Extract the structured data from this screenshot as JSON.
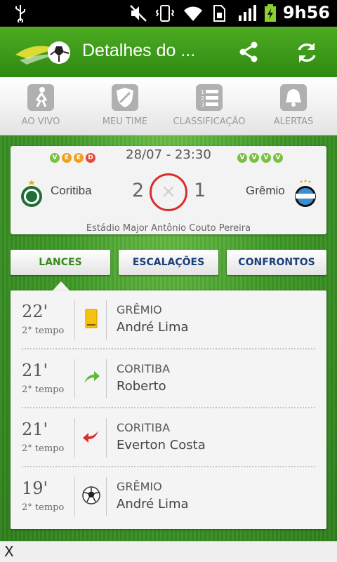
{
  "status_bar": {
    "time": "9h56",
    "icons": [
      "usb-icon",
      "mute-icon",
      "vibrate-icon",
      "wifi-icon",
      "sim-icon",
      "signal-icon",
      "battery-charging-icon"
    ]
  },
  "app_bar": {
    "title": "Detalhes do ...",
    "logo_icon": "soccer-ball-logo",
    "share_icon": "share-icon",
    "refresh_icon": "refresh-icon",
    "accent": "#3b9b1b"
  },
  "tabs": [
    {
      "label": "AO VIVO",
      "icon": "player-icon"
    },
    {
      "label": "MEU TIME",
      "icon": "shield-icon"
    },
    {
      "label": "CLASSIFICAÇÃO",
      "icon": "ranking-list-icon"
    },
    {
      "label": "ALERTAS",
      "icon": "bell-icon"
    }
  ],
  "match": {
    "datetime": "28/07 - 23:30",
    "home": {
      "name": "Coritiba",
      "score": "2",
      "form": [
        "V",
        "E",
        "E",
        "D"
      ]
    },
    "away": {
      "name": "Grêmio",
      "score": "1",
      "form": [
        "V",
        "V",
        "V",
        "V"
      ]
    },
    "vs_symbol": "×",
    "stadium": "Estádio Major Antônio Couto Pereira",
    "form_colors": {
      "V": "#7ac143",
      "E": "#f0a020",
      "D": "#e24a3b"
    }
  },
  "segments": [
    {
      "label": "LANCES",
      "active": true
    },
    {
      "label": "ESCALAÇÕES",
      "active": false
    },
    {
      "label": "CONFRONTOS",
      "active": false
    }
  ],
  "events": [
    {
      "minute": "22'",
      "period": "2° tempo",
      "team": "GRÊMIO",
      "player": "André Lima",
      "icon": "yellow-card-icon"
    },
    {
      "minute": "21'",
      "period": "2° tempo",
      "team": "CORITIBA",
      "player": "Roberto",
      "icon": "substitution-in-icon"
    },
    {
      "minute": "21'",
      "period": "2° tempo",
      "team": "CORITIBA",
      "player": "Everton Costa",
      "icon": "substitution-out-icon"
    },
    {
      "minute": "19'",
      "period": "2° tempo",
      "team": "GRÊMIO",
      "player": "André Lima",
      "icon": "goal-ball-icon"
    }
  ],
  "bottom_bar": {
    "close_label": "X"
  }
}
